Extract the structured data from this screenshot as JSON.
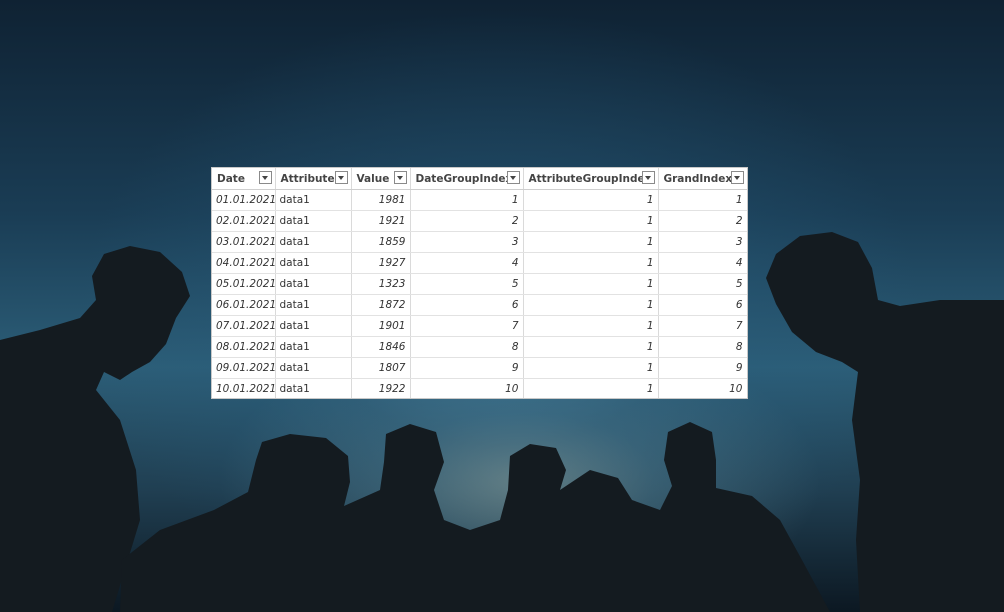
{
  "table": {
    "columns": [
      {
        "label": "Date",
        "key": "date",
        "align": "date"
      },
      {
        "label": "Attribute",
        "key": "attribute",
        "align": "text"
      },
      {
        "label": "Value",
        "key": "value",
        "align": "num"
      },
      {
        "label": "DateGroupIndex",
        "key": "dateGroupIndex",
        "align": "num"
      },
      {
        "label": "AttributeGroupIndex",
        "key": "attributeGroupIndex",
        "align": "num"
      },
      {
        "label": "GrandIndex",
        "key": "grandIndex",
        "align": "num"
      }
    ],
    "rows": [
      {
        "date": "01.01.2021",
        "attribute": "data1",
        "value": "1981",
        "dateGroupIndex": "1",
        "attributeGroupIndex": "1",
        "grandIndex": "1"
      },
      {
        "date": "02.01.2021",
        "attribute": "data1",
        "value": "1921",
        "dateGroupIndex": "2",
        "attributeGroupIndex": "1",
        "grandIndex": "2"
      },
      {
        "date": "03.01.2021",
        "attribute": "data1",
        "value": "1859",
        "dateGroupIndex": "3",
        "attributeGroupIndex": "1",
        "grandIndex": "3"
      },
      {
        "date": "04.01.2021",
        "attribute": "data1",
        "value": "1927",
        "dateGroupIndex": "4",
        "attributeGroupIndex": "1",
        "grandIndex": "4"
      },
      {
        "date": "05.01.2021",
        "attribute": "data1",
        "value": "1323",
        "dateGroupIndex": "5",
        "attributeGroupIndex": "1",
        "grandIndex": "5"
      },
      {
        "date": "06.01.2021",
        "attribute": "data1",
        "value": "1872",
        "dateGroupIndex": "6",
        "attributeGroupIndex": "1",
        "grandIndex": "6"
      },
      {
        "date": "07.01.2021",
        "attribute": "data1",
        "value": "1901",
        "dateGroupIndex": "7",
        "attributeGroupIndex": "1",
        "grandIndex": "7"
      },
      {
        "date": "08.01.2021",
        "attribute": "data1",
        "value": "1846",
        "dateGroupIndex": "8",
        "attributeGroupIndex": "1",
        "grandIndex": "8"
      },
      {
        "date": "09.01.2021",
        "attribute": "data1",
        "value": "1807",
        "dateGroupIndex": "9",
        "attributeGroupIndex": "1",
        "grandIndex": "9"
      },
      {
        "date": "10.01.2021",
        "attribute": "data1",
        "value": "1922",
        "dateGroupIndex": "10",
        "attributeGroupIndex": "1",
        "grandIndex": "10"
      }
    ]
  },
  "background": {
    "subject": "silhouettes-of-people-against-evening-sky",
    "sky_color": "#2c5e78",
    "glow_color": "#b9c4b0",
    "silhouette_color": "#141b20"
  }
}
